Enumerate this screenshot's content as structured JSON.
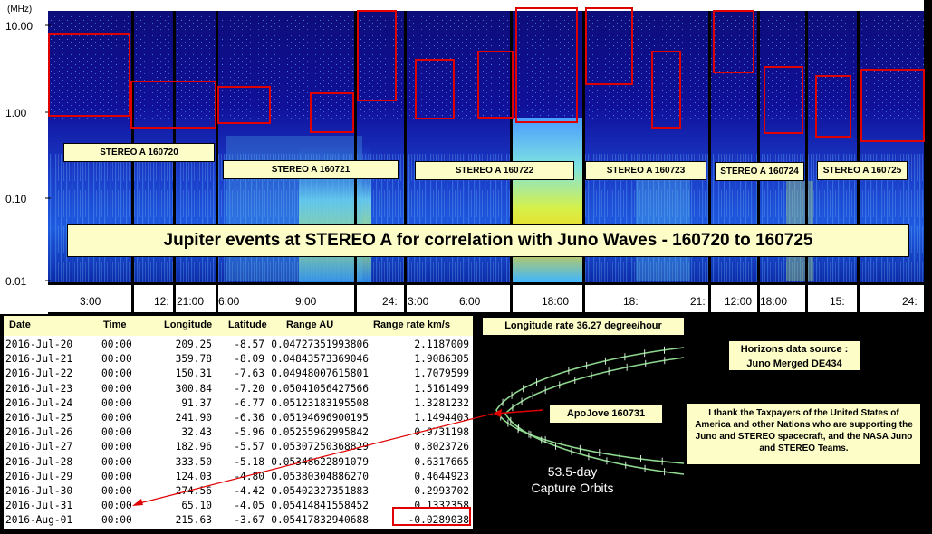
{
  "spectrogram": {
    "y_axis_unit": "(MHz)",
    "y_ticks": [
      "10.00",
      "1.00",
      "0.10",
      "0.01"
    ],
    "x_ticks": [
      "3:00",
      "12:",
      "21:00",
      "6:00",
      "9:00",
      "24:",
      "3:00",
      "6:00",
      "18:00",
      "18:",
      "21:",
      "12:00",
      "18:00",
      "15:",
      "24:"
    ],
    "day_labels": [
      "STEREO A 160720",
      "STEREO A 160721",
      "STEREO A 160722",
      "STEREO A 160723",
      "STEREO A 160724",
      "STEREO A 160725"
    ],
    "title": "Jupiter events at STEREO A for correlation with Juno Waves - 160720 to 160725"
  },
  "table": {
    "headers": [
      "Date",
      "Time",
      "Longitude",
      "Latitude",
      "Range AU",
      "Range rate km/s"
    ],
    "rows": [
      [
        "2016-Jul-20",
        "00:00",
        "209.25",
        "-8.57",
        "0.04727351993806",
        "2.1187009"
      ],
      [
        "2016-Jul-21",
        "00:00",
        "359.78",
        "-8.09",
        "0.04843573369046",
        "1.9086305"
      ],
      [
        "2016-Jul-22",
        "00:00",
        "150.31",
        "-7.63",
        "0.04948007615801",
        "1.7079599"
      ],
      [
        "2016-Jul-23",
        "00:00",
        "300.84",
        "-7.20",
        "0.05041056427566",
        "1.5161499"
      ],
      [
        "2016-Jul-24",
        "00:00",
        "91.37",
        "-6.77",
        "0.05123183195508",
        "1.3281232"
      ],
      [
        "2016-Jul-25",
        "00:00",
        "241.90",
        "-6.36",
        "0.05194696900195",
        "1.1494403"
      ],
      [
        "2016-Jul-26",
        "00:00",
        "32.43",
        "-5.96",
        "0.05255962995842",
        "0.9731198"
      ],
      [
        "2016-Jul-27",
        "00:00",
        "182.96",
        "-5.57",
        "0.05307250368829",
        "0.8023726"
      ],
      [
        "2016-Jul-28",
        "00:00",
        "333.50",
        "-5.18",
        "0.05348622891079",
        "0.6317665"
      ],
      [
        "2016-Jul-29",
        "00:00",
        "124.03",
        "-4.80",
        "0.05380304886270",
        "0.4644923"
      ],
      [
        "2016-Jul-30",
        "00:00",
        "274.56",
        "-4.42",
        "0.05402327351883",
        "0.2993702"
      ],
      [
        "2016-Jul-31",
        "00:00",
        "65.10",
        "-4.05",
        "0.05414841558452",
        "0.1332358"
      ],
      [
        "2016-Aug-01",
        "00:00",
        "215.63",
        "-3.67",
        "0.05417832940688",
        "-0.0289038"
      ]
    ]
  },
  "orbit_panel": {
    "header": "Longitude rate 36.27 degree/hour",
    "apojove_label": "ApoJove 160731",
    "caption_line1": "53.5-day",
    "caption_line2": "Capture Orbits"
  },
  "horizons": {
    "line1": "Horizons data source :",
    "line2": "Juno Merged DE434"
  },
  "thanks": {
    "text": "I thank the Taxpayers of the United States of America and other Nations who are supporting the Juno and STEREO spacecraft, and the NASA Juno and STEREO Teams."
  },
  "colors": {
    "label_bg": "#fdfdc8",
    "box_red": "#e00000",
    "spectrogram_dark": "#0a0a8c"
  }
}
